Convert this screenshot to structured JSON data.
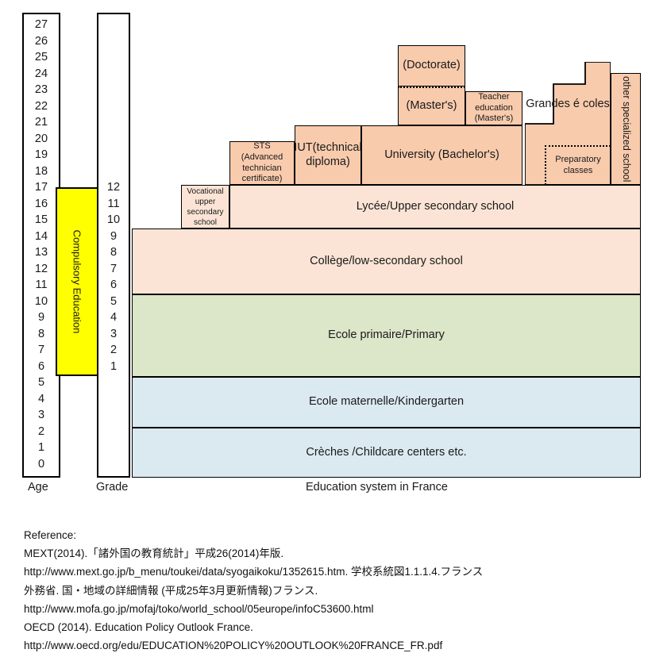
{
  "axes": {
    "age_caption": "Age",
    "grade_caption": "Grade",
    "age_ticks": [
      27,
      26,
      25,
      24,
      23,
      22,
      21,
      20,
      19,
      18,
      17,
      16,
      15,
      14,
      13,
      12,
      11,
      10,
      9,
      8,
      7,
      6,
      5,
      4,
      3,
      2,
      1,
      0
    ],
    "grade_ticks": [
      12,
      11,
      10,
      9,
      8,
      7,
      6,
      5,
      4,
      3,
      2,
      1
    ],
    "compulsory_label": "Compulsory Education"
  },
  "chart_caption": "Education system in France",
  "blocks": {
    "doctorate": "(Doctorate)",
    "masters": "(Master's)",
    "teacher_education": "Teacher education (Master's)",
    "university_bachelors": "University (Bachelor's)",
    "sts": "STS (Advanced technician certificate)",
    "iut": "IUT(technical diploma)",
    "vocational": "Vocational upper secondary school",
    "lycee": "Lycée/Upper secondary school",
    "college": "Collège/low-secondary school",
    "primary": "Ecole primaire/Primary",
    "kindergarten": "Ecole maternelle/Kindergarten",
    "creches": "Crèches /Childcare centers etc.",
    "grandes_ecoles": "Grandes é coles",
    "preparatory_classes": "Preparatory classes",
    "other_specialized": "other specialized school"
  },
  "colors": {
    "peach": "#F8CBAD",
    "peach_light": "#FBE4D5",
    "green": "#DCE6C8",
    "blue": "#DBE9F1",
    "compulsory_yellow": "#FFFF00"
  },
  "reference": {
    "heading": "Reference:",
    "lines": [
      "MEXT(2014).「諸外国の教育統計」平成26(2014)年版.",
      "http://www.mext.go.jp/b_menu/toukei/data/syogaikoku/1352615.htm. 学校系統図1.1.1.4.フランス",
      "外務省. 国・地域の詳細情報 (平成25年3月更新情報)フランス.",
      "http://www.mofa.go.jp/mofaj/toko/world_school/05europe/infoC53600.html",
      "OECD (2014). Education Policy Outlook France.",
      "http://www.oecd.org/edu/EDUCATION%20POLICY%20OUTLOOK%20FRANCE_FR.pdf"
    ]
  }
}
